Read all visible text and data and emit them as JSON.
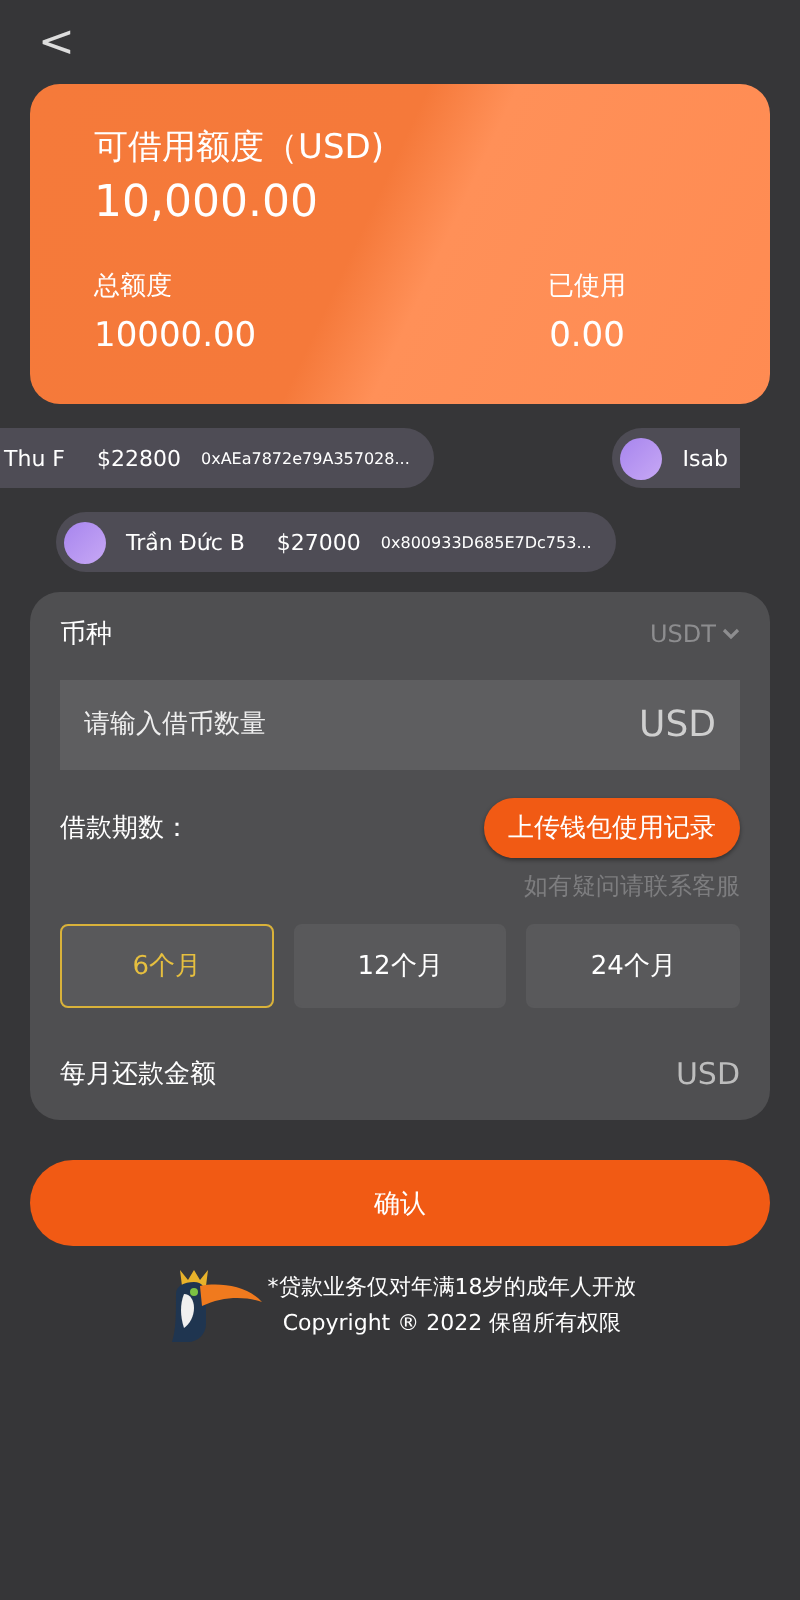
{
  "header": {
    "back": "<"
  },
  "credit_card": {
    "title": "可借用额度（USD)",
    "available": "10,000.00",
    "stats": [
      {
        "label": "总额度",
        "value": "10000.00"
      },
      {
        "label": "已使用",
        "value": "0.00"
      }
    ]
  },
  "ticker_rows": [
    {
      "items": [
        {
          "name": "Thu F",
          "amount": "$22800",
          "address": "0xAEa7872e79A357028...",
          "avatar": false
        },
        {
          "name": "Isab",
          "avatar": true
        }
      ]
    },
    {
      "items": [
        {
          "name": "Trần Đức B",
          "amount": "$27000",
          "address": "0x800933D685E7Dc753...",
          "avatar": true
        }
      ]
    }
  ],
  "form": {
    "currency_label": "币种",
    "currency_value": "USDT",
    "amount_placeholder": "请输入借币数量",
    "amount_unit": "USD",
    "period_label": "借款期数：",
    "upload_button": "上传钱包使用记录",
    "help_text": "如有疑问请联系客服",
    "periods": [
      {
        "label": "6个月",
        "selected": true
      },
      {
        "label": "12个月",
        "selected": false
      },
      {
        "label": "24个月",
        "selected": false
      }
    ],
    "monthly_label": "每月还款金额",
    "monthly_unit": "USD"
  },
  "confirm_button": "确认",
  "footer": {
    "notice": "*贷款业务仅对年满18岁的成年人开放",
    "copyright": "Copyright ® 2022 保留所有权限"
  }
}
